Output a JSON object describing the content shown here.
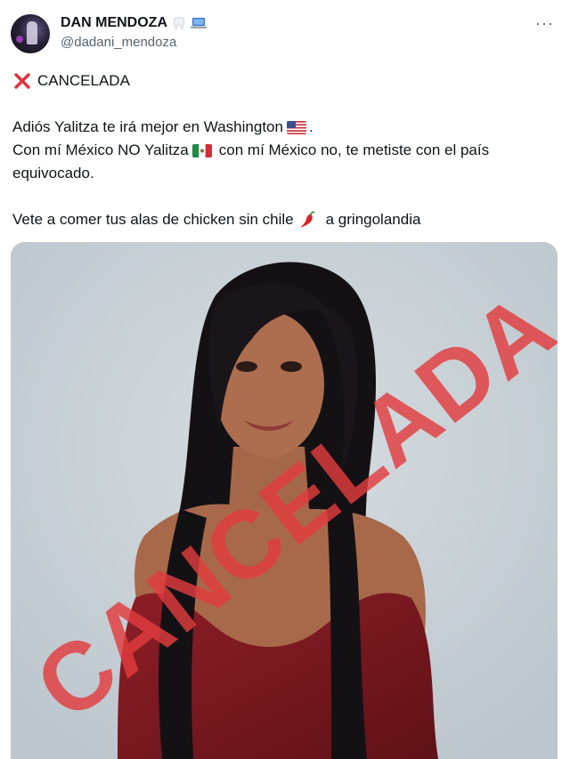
{
  "author": {
    "name": "DAN MENDOZA",
    "handle": "@dadani_mendoza",
    "name_icons": [
      "tooth-icon",
      "laptop-icon"
    ]
  },
  "more_label": "···",
  "tweet": {
    "line1": "CANCELADA",
    "line2a": "Adiós Yalitza te irá mejor en Washington",
    "line2b": ".",
    "line3a": "Con mí México NO Yalitza",
    "line3b": "con mí México no, te metiste con el país",
    "line4": "equivocado.",
    "line5a": "Vete a comer tus alas de chicken sin chile",
    "line5b": "a gringolandia"
  },
  "media": {
    "stamp_text": "CANCELADA",
    "stamp_color": "#e23c3e"
  },
  "colors": {
    "text": "#0f1419",
    "secondary": "#536471",
    "background": "#ffffff"
  }
}
